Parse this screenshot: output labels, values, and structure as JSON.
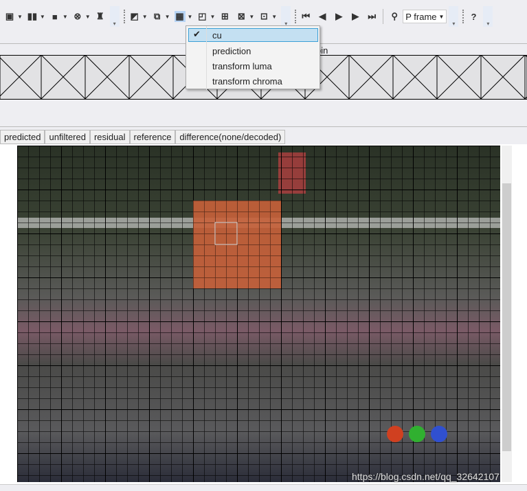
{
  "toolbar": {
    "icons": [
      "windows-icon",
      "bar-chart-icon",
      "block-icon",
      "filter-icon",
      "bug-icon",
      "split-icon",
      "step-icon",
      "grid-cu-icon",
      "motion-icon",
      "grid4-icon",
      "grid4x-icon",
      "zoom-box-icon",
      "first-frame-icon",
      "prev-frame-icon",
      "play-icon",
      "next-frame-icon",
      "last-frame-icon",
      "search-icon",
      "help-icon"
    ],
    "frame_select": "P frame",
    "help": "?"
  },
  "menu": {
    "items": [
      {
        "label": "cu",
        "checked": true
      },
      {
        "label": "prediction"
      },
      {
        "label": "transform luma"
      },
      {
        "label": "transform chroma"
      }
    ]
  },
  "partial_label": "pin",
  "tabs": [
    "predicted",
    "unfiltered",
    "residual",
    "reference",
    "difference(none/decoded)"
  ],
  "watermark": "https://blog.csdn.net/qq_32642107",
  "colors": {
    "highlight": "#c8603a",
    "menu_selected": "#c4e0f2",
    "toolbar_selected": "#b7d4f5"
  }
}
